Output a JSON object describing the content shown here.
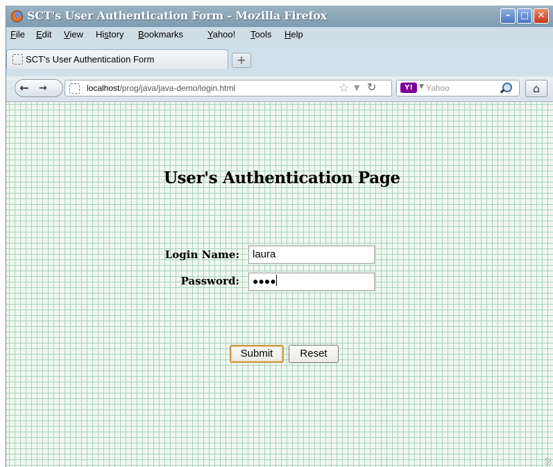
{
  "window": {
    "title": "SCT's User Authentication Form - Mozilla Firefox",
    "controls": {
      "minimize": "–",
      "maximize": "□",
      "close": "✕"
    }
  },
  "menubar": {
    "items": [
      {
        "label": "File",
        "key": "F",
        "rest": "ile"
      },
      {
        "label": "Edit",
        "key": "E",
        "rest": "dit"
      },
      {
        "label": "View",
        "key": "V",
        "rest": "iew"
      },
      {
        "label": "History",
        "pre": "Hi",
        "key": "s",
        "rest": "tory"
      },
      {
        "label": "Bookmarks",
        "key": "B",
        "rest": "ookmarks"
      },
      {
        "label": "Yahoo!",
        "key": "Y",
        "rest": "ahoo!"
      },
      {
        "label": "Tools",
        "key": "T",
        "rest": "ools"
      },
      {
        "label": "Help",
        "key": "H",
        "rest": "elp"
      }
    ]
  },
  "tabs": [
    {
      "title": "SCT's User Authentication Form"
    }
  ],
  "newtab": {
    "label": "+"
  },
  "navbar": {
    "url_host": "localhost",
    "url_path": "/prog/java/java-demo/login.html",
    "search_engine": "Y!",
    "search_placeholder": "Yahoo"
  },
  "page": {
    "heading": "User's Authentication Page",
    "login_label": "Login Name:",
    "login_value": "laura",
    "password_label": "Password:",
    "password_mask": "●●●●",
    "submit_label": "Submit",
    "reset_label": "Reset"
  },
  "colors": {
    "grid_line": "#a8d3ba",
    "page_bg": "#f0f7f1",
    "submit_border": "#c9994a"
  }
}
